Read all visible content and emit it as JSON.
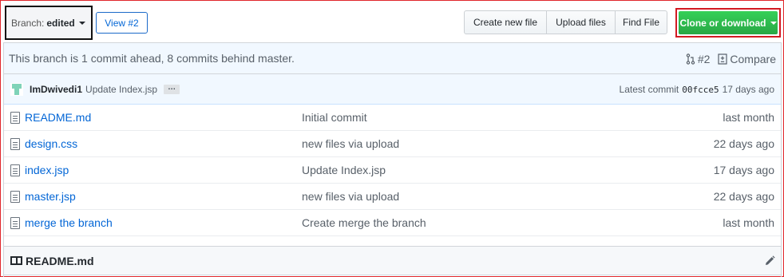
{
  "toolbar": {
    "branch_label": "Branch:",
    "branch_name": "edited",
    "view_pr": "View #2",
    "buttons": [
      "Create new file",
      "Upload files",
      "Find File"
    ],
    "clone": "Clone or download"
  },
  "status": {
    "ahead_text": "This branch is 1 commit ahead, 8 commits behind master.",
    "pr_link": "#2",
    "compare": "Compare"
  },
  "commit": {
    "author": "ImDwivedi1",
    "message": "Update Index.jsp",
    "ellipsis": "…",
    "latest_label": "Latest commit",
    "sha": "00fcce5",
    "age": "17 days ago"
  },
  "files": [
    {
      "name": "README.md",
      "message": "Initial commit",
      "age": "last month"
    },
    {
      "name": "design.css",
      "message": "new files via upload",
      "age": "22 days ago"
    },
    {
      "name": "index.jsp",
      "message": "Update Index.jsp",
      "age": "17 days ago"
    },
    {
      "name": "master.jsp",
      "message": "new files via upload",
      "age": "22 days ago"
    },
    {
      "name": "merge the branch",
      "message": "Create merge the branch",
      "age": "last month"
    }
  ],
  "readme": {
    "title": "README.md"
  },
  "colors": {
    "link": "#0366d6",
    "clone_green": "#28a745",
    "highlight_red": "#d21a22",
    "commit_bg": "#f1f8ff"
  }
}
